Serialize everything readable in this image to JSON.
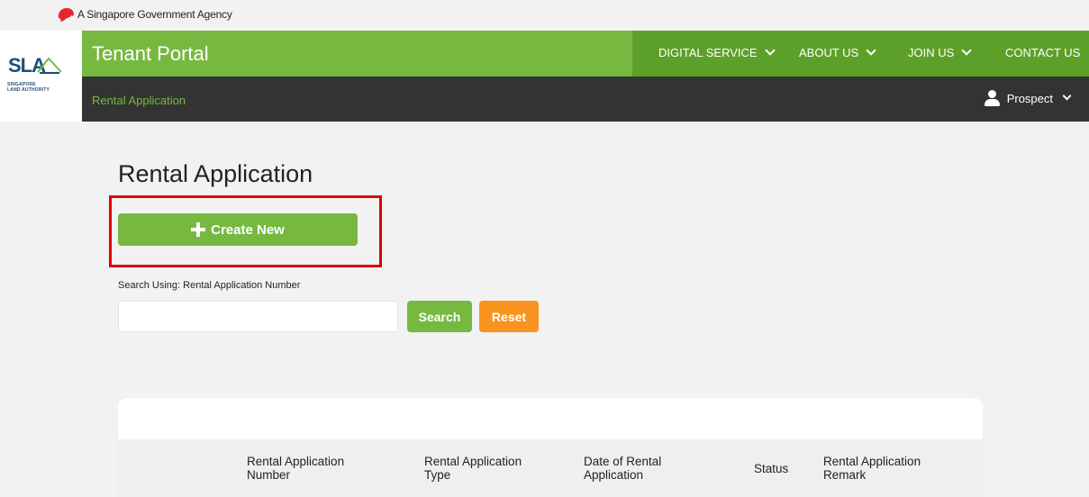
{
  "gov_banner": {
    "text": "A Singapore Government Agency"
  },
  "brand": {
    "logo_text": "SLA",
    "logo_sub_line1": "SINGAPORE",
    "logo_sub_line2": "LAND AUTHORITY",
    "accent": "#77b940"
  },
  "header": {
    "title": "Tenant Portal"
  },
  "nav": {
    "items": [
      {
        "label": "DIGITAL SERVICE",
        "has_dropdown": true
      },
      {
        "label": "ABOUT US",
        "has_dropdown": true
      },
      {
        "label": "JOIN US",
        "has_dropdown": true
      },
      {
        "label": "CONTACT US",
        "has_dropdown": false
      }
    ]
  },
  "subnav": {
    "breadcrumb": "Rental Application",
    "user_label": "Prospect"
  },
  "main": {
    "title": "Rental Application",
    "create_button": "Create New",
    "search_label": "Search Using: Rental Application Number",
    "search_value": "",
    "search_button": "Search",
    "reset_button": "Reset"
  },
  "table": {
    "columns": [
      {
        "line1": "Rental Application",
        "line2": "Number"
      },
      {
        "line1": "Rental Application",
        "line2": "Type"
      },
      {
        "line1": "Date of Rental",
        "line2": "Application"
      },
      {
        "line1": "Status",
        "line2": ""
      },
      {
        "line1": "Rental Application",
        "line2": "Remark"
      }
    ]
  },
  "colors": {
    "green": "#77b940",
    "dark_green": "#5da029",
    "dark_bar": "#333333",
    "orange": "#f7931e",
    "highlight": "#e00000"
  }
}
